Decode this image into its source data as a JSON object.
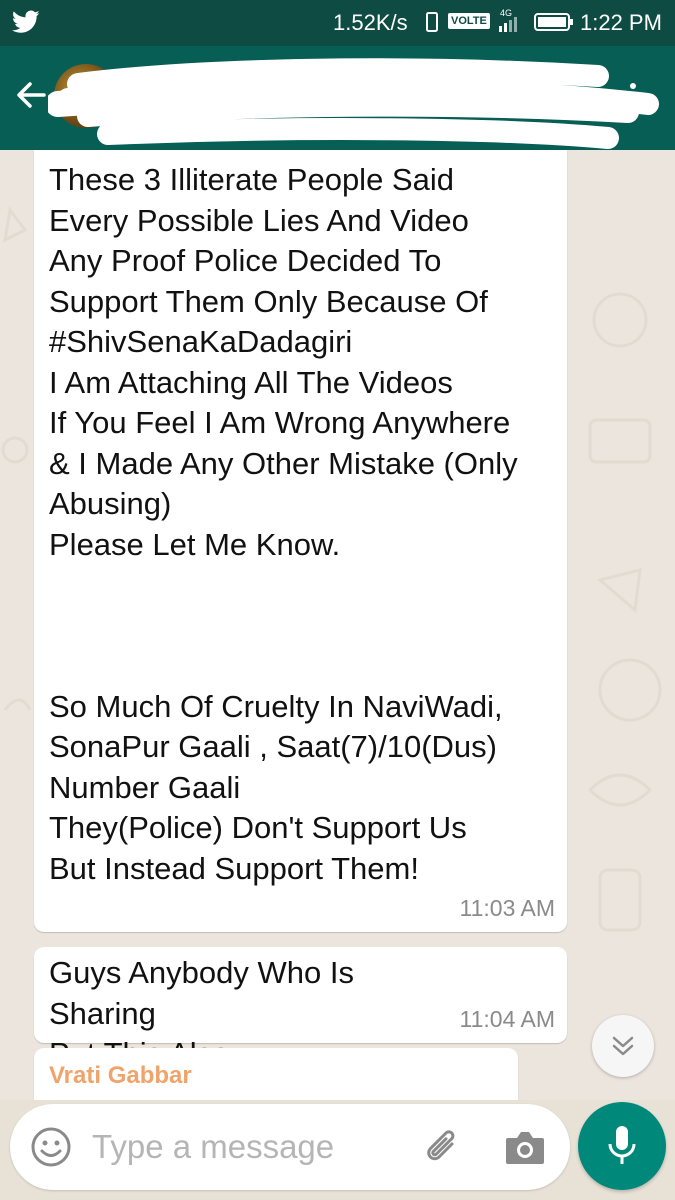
{
  "status_bar": {
    "speed": "1.52K/s",
    "volte": "VOLTE",
    "network": "4G",
    "time": "1:22 PM"
  },
  "header": {
    "back_icon": "arrow-left-icon",
    "menu_icon": "more-vert-icon"
  },
  "messages": [
    {
      "text": "These 3 Illiterate People Said\nEvery Possible Lies And Video\nAny Proof Police Decided To\nSupport Them Only Because Of\n#ShivSenaKaDadagiri\nI Am Attaching All The Videos\nIf You Feel I Am Wrong Anywhere\n& I Made Any Other Mistake (Only\nAbusing)\nPlease Let Me Know.\n\n\n\nSo Much Of Cruelty In NaviWadi,\nSonaPur Gaali , Saat(7)/10(Dus)\nNumber Gaali\nThey(Police) Don't Support Us\nBut Instead Support Them!",
      "time": "11:03 AM"
    },
    {
      "text": "Guys Anybody Who Is Sharing\nPut This Also",
      "time": "11:04 AM"
    },
    {
      "sender": "Vrati Gabbar"
    }
  ],
  "input": {
    "placeholder": "Type a message"
  },
  "colors": {
    "status_bar": "#0e4c43",
    "header": "#075e54",
    "accent": "#00897b",
    "sender": "#f0a46b"
  }
}
